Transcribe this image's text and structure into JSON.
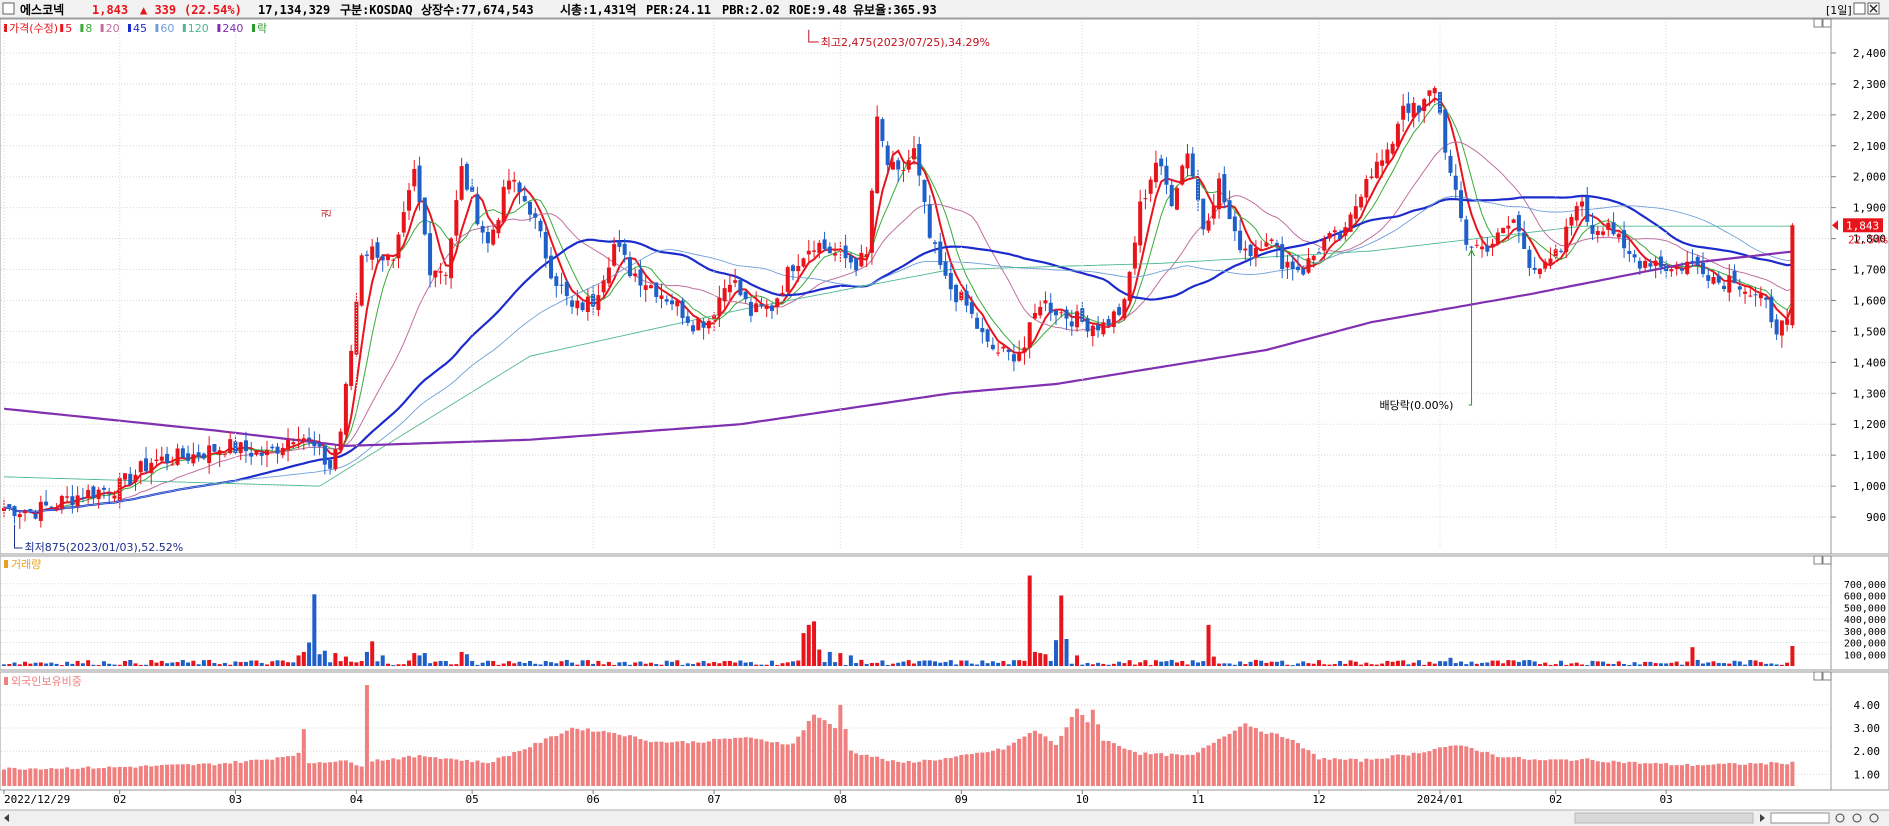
{
  "header": {
    "stock_name": "에스코넥",
    "price": "1,843",
    "change": "▲ 339",
    "change_pct": "(22.54%)",
    "volume": "17,134,329",
    "market": "구분:KOSDAQ",
    "shares": "상장수:77,674,543",
    "market_cap": "시총:1,431억",
    "per": "PER:24.11",
    "pbr": "PBR:2.02",
    "roe": "ROE:9.48",
    "float": "유보율:365.93",
    "period": "[1일]"
  },
  "colors": {
    "up": "#e8141c",
    "down": "#1f5fc8",
    "ma5": "#e8141c",
    "ma8": "#3aaa3a",
    "ma20": "#c070a0",
    "ma45": "#1c2ccc",
    "ma60": "#70a0d8",
    "ma120": "#50b890",
    "ma240": "#8030b0",
    "foreign": "#f08080",
    "grid": "#d8d8d8"
  },
  "legend": {
    "price": "가격(수정)",
    "ma": [
      "5",
      "8",
      "20",
      "45",
      "60",
      "120",
      "240"
    ],
    "drop": "락"
  },
  "annotations": {
    "high": "최고2,475(2023/07/25),34.29%",
    "low": "최저875(2023/01/03),52.52%",
    "dividend": "배당락(0.00%)",
    "rights_marker": "권"
  },
  "right_labels": {
    "current_price": "1,843",
    "current_pct": "22.54%"
  },
  "x_axis": {
    "labels": [
      "2022/12/29",
      "02",
      "03",
      "04",
      "05",
      "06",
      "07",
      "08",
      "09",
      "10",
      "11",
      "12",
      "2024/01",
      "02",
      "03"
    ]
  },
  "panels": {
    "volume_title": "거래량",
    "foreign_title": "외국인보유비중"
  },
  "chart_data": [
    {
      "type": "candlestick",
      "title": "가격(수정)",
      "ylim": [
        800,
        2500
      ],
      "yticks": [
        "900",
        "1,000",
        "1,100",
        "1,200",
        "1,300",
        "1,400",
        "1,500",
        "1,600",
        "1,700",
        "1,800",
        "1,900",
        "2,000",
        "2,100",
        "2,200",
        "2,300",
        "2,400"
      ],
      "anchors": [
        [
          0,
          930
        ],
        [
          6,
          920
        ],
        [
          14,
          970
        ],
        [
          22,
          1000
        ],
        [
          28,
          1080
        ],
        [
          36,
          1100
        ],
        [
          42,
          1130
        ],
        [
          50,
          1100
        ],
        [
          56,
          1180
        ],
        [
          62,
          1060
        ],
        [
          64,
          1180
        ],
        [
          66,
          1440
        ],
        [
          68,
          1760
        ],
        [
          71,
          1760
        ],
        [
          74,
          1710
        ],
        [
          78,
          2010
        ],
        [
          81,
          1710
        ],
        [
          84,
          1700
        ],
        [
          87,
          2020
        ],
        [
          92,
          1780
        ],
        [
          96,
          1990
        ],
        [
          100,
          1900
        ],
        [
          104,
          1700
        ],
        [
          108,
          1570
        ],
        [
          112,
          1600
        ],
        [
          116,
          1780
        ],
        [
          119,
          1700
        ],
        [
          123,
          1650
        ],
        [
          127,
          1600
        ],
        [
          131,
          1530
        ],
        [
          134,
          1540
        ],
        [
          138,
          1680
        ],
        [
          142,
          1560
        ],
        [
          146,
          1580
        ],
        [
          150,
          1720
        ],
        [
          154,
          1790
        ],
        [
          158,
          1750
        ],
        [
          162,
          1720
        ],
        [
          164,
          1740
        ],
        [
          166,
          2170
        ],
        [
          168,
          2040
        ],
        [
          170,
          2000
        ],
        [
          173,
          2080
        ],
        [
          176,
          1800
        ],
        [
          179,
          1660
        ],
        [
          183,
          1580
        ],
        [
          187,
          1450
        ],
        [
          191,
          1420
        ],
        [
          194,
          1450
        ],
        [
          197,
          1600
        ],
        [
          201,
          1560
        ],
        [
          205,
          1530
        ],
        [
          209,
          1520
        ],
        [
          213,
          1580
        ],
        [
          216,
          1900
        ],
        [
          219,
          2050
        ],
        [
          222,
          1930
        ],
        [
          225,
          2090
        ],
        [
          228,
          1840
        ],
        [
          231,
          1980
        ],
        [
          234,
          1800
        ],
        [
          237,
          1760
        ],
        [
          240,
          1810
        ],
        [
          243,
          1730
        ],
        [
          247,
          1700
        ],
        [
          251,
          1790
        ],
        [
          255,
          1810
        ],
        [
          259,
          2010
        ],
        [
          263,
          2060
        ],
        [
          266,
          2240
        ],
        [
          269,
          2200
        ],
        [
          272,
          2300
        ],
        [
          275,
          2000
        ],
        [
          278,
          1790
        ],
        [
          281,
          1770
        ],
        [
          284,
          1800
        ],
        [
          287,
          1860
        ],
        [
          290,
          1730
        ],
        [
          293,
          1700
        ],
        [
          296,
          1760
        ],
        [
          299,
          1930
        ],
        [
          302,
          1830
        ],
        [
          305,
          1860
        ],
        [
          308,
          1750
        ],
        [
          311,
          1730
        ],
        [
          314,
          1730
        ],
        [
          317,
          1700
        ],
        [
          320,
          1720
        ],
        [
          323,
          1710
        ],
        [
          326,
          1660
        ],
        [
          329,
          1680
        ],
        [
          332,
          1620
        ],
        [
          335,
          1580
        ],
        [
          337,
          1520
        ],
        [
          339,
          1510
        ],
        [
          340,
          1504
        ]
      ],
      "last_candle": {
        "open": 1520,
        "high": 1850,
        "low": 1510,
        "close": 1843
      },
      "moving_averages": [
        {
          "name": "5",
          "period": 5
        },
        {
          "name": "8",
          "period": 8
        },
        {
          "name": "20",
          "period": 20
        },
        {
          "name": "45",
          "period": 45
        },
        {
          "name": "60",
          "period": 60
        },
        {
          "name": "120",
          "period": 120
        },
        {
          "name": "240",
          "period": 240
        }
      ],
      "ma240_anchors": [
        [
          0,
          1250
        ],
        [
          40,
          1180
        ],
        [
          65,
          1130
        ],
        [
          100,
          1150
        ],
        [
          140,
          1200
        ],
        [
          180,
          1300
        ],
        [
          200,
          1330
        ],
        [
          240,
          1440
        ],
        [
          260,
          1530
        ],
        [
          290,
          1620
        ],
        [
          320,
          1720
        ],
        [
          341,
          1760
        ]
      ],
      "ma120_anchors": [
        [
          0,
          1030
        ],
        [
          60,
          1000
        ],
        [
          100,
          1420
        ],
        [
          140,
          1570
        ],
        [
          180,
          1700
        ],
        [
          220,
          1720
        ],
        [
          260,
          1760
        ],
        [
          300,
          1840
        ],
        [
          341,
          1840
        ]
      ],
      "x_label_index": [
        0,
        22,
        44,
        67,
        89,
        112,
        135,
        159,
        182,
        205,
        227,
        250,
        273,
        295,
        316
      ]
    },
    {
      "type": "bar",
      "title": "거래량",
      "ylim": [
        0,
        800000
      ],
      "yticks": [
        "100,000",
        "200,000",
        "300,000",
        "400,000",
        "500,000",
        "600,000",
        "700,000"
      ],
      "spikes": [
        [
          56,
          90000
        ],
        [
          57,
          120000
        ],
        [
          58,
          200000
        ],
        [
          59,
          610000
        ],
        [
          60,
          100000
        ],
        [
          61,
          130000
        ],
        [
          63,
          110000
        ],
        [
          65,
          80000
        ],
        [
          69,
          120000
        ],
        [
          70,
          210000
        ],
        [
          72,
          90000
        ],
        [
          78,
          110000
        ],
        [
          79,
          90000
        ],
        [
          80,
          110000
        ],
        [
          87,
          120000
        ],
        [
          88,
          100000
        ],
        [
          152,
          280000
        ],
        [
          153,
          350000
        ],
        [
          154,
          380000
        ],
        [
          155,
          140000
        ],
        [
          157,
          120000
        ],
        [
          159,
          110000
        ],
        [
          161,
          90000
        ],
        [
          195,
          770000
        ],
        [
          196,
          120000
        ],
        [
          197,
          110000
        ],
        [
          198,
          100000
        ],
        [
          200,
          220000
        ],
        [
          201,
          600000
        ],
        [
          202,
          230000
        ],
        [
          204,
          90000
        ],
        [
          229,
          350000
        ],
        [
          230,
          80000
        ],
        [
          275,
          70000
        ],
        [
          321,
          160000
        ],
        [
          340,
          170000
        ]
      ],
      "baseline_volume": 25000
    },
    {
      "type": "bar",
      "title": "외국인보유비중",
      "ylim": [
        0.5,
        4.9
      ],
      "yticks": [
        "1.00",
        "2.00",
        "3.00",
        "4.00"
      ],
      "anchors": [
        [
          0,
          1.25
        ],
        [
          20,
          1.3
        ],
        [
          40,
          1.45
        ],
        [
          50,
          1.65
        ],
        [
          56,
          1.9
        ],
        [
          57,
          2.9
        ],
        [
          58,
          1.5
        ],
        [
          64,
          1.6
        ],
        [
          68,
          1.4
        ],
        [
          69,
          4.9
        ],
        [
          70,
          1.6
        ],
        [
          80,
          1.8
        ],
        [
          92,
          1.5
        ],
        [
          100,
          2.2
        ],
        [
          104,
          2.6
        ],
        [
          108,
          3.0
        ],
        [
          116,
          2.8
        ],
        [
          124,
          2.4
        ],
        [
          132,
          2.4
        ],
        [
          140,
          2.6
        ],
        [
          150,
          2.3
        ],
        [
          154,
          3.6
        ],
        [
          158,
          3.0
        ],
        [
          159,
          4.0
        ],
        [
          161,
          2.0
        ],
        [
          170,
          1.5
        ],
        [
          180,
          1.7
        ],
        [
          190,
          2.1
        ],
        [
          196,
          2.9
        ],
        [
          200,
          2.3
        ],
        [
          204,
          3.8
        ],
        [
          206,
          3.3
        ],
        [
          207,
          3.8
        ],
        [
          209,
          2.5
        ],
        [
          216,
          1.9
        ],
        [
          226,
          1.8
        ],
        [
          230,
          2.4
        ],
        [
          236,
          3.2
        ],
        [
          240,
          2.8
        ],
        [
          244,
          2.6
        ],
        [
          250,
          1.7
        ],
        [
          258,
          1.6
        ],
        [
          268,
          1.9
        ],
        [
          274,
          2.2
        ],
        [
          278,
          2.2
        ],
        [
          284,
          1.8
        ],
        [
          292,
          1.6
        ],
        [
          300,
          1.65
        ],
        [
          310,
          1.5
        ],
        [
          320,
          1.4
        ],
        [
          330,
          1.45
        ],
        [
          340,
          1.5
        ]
      ]
    }
  ]
}
